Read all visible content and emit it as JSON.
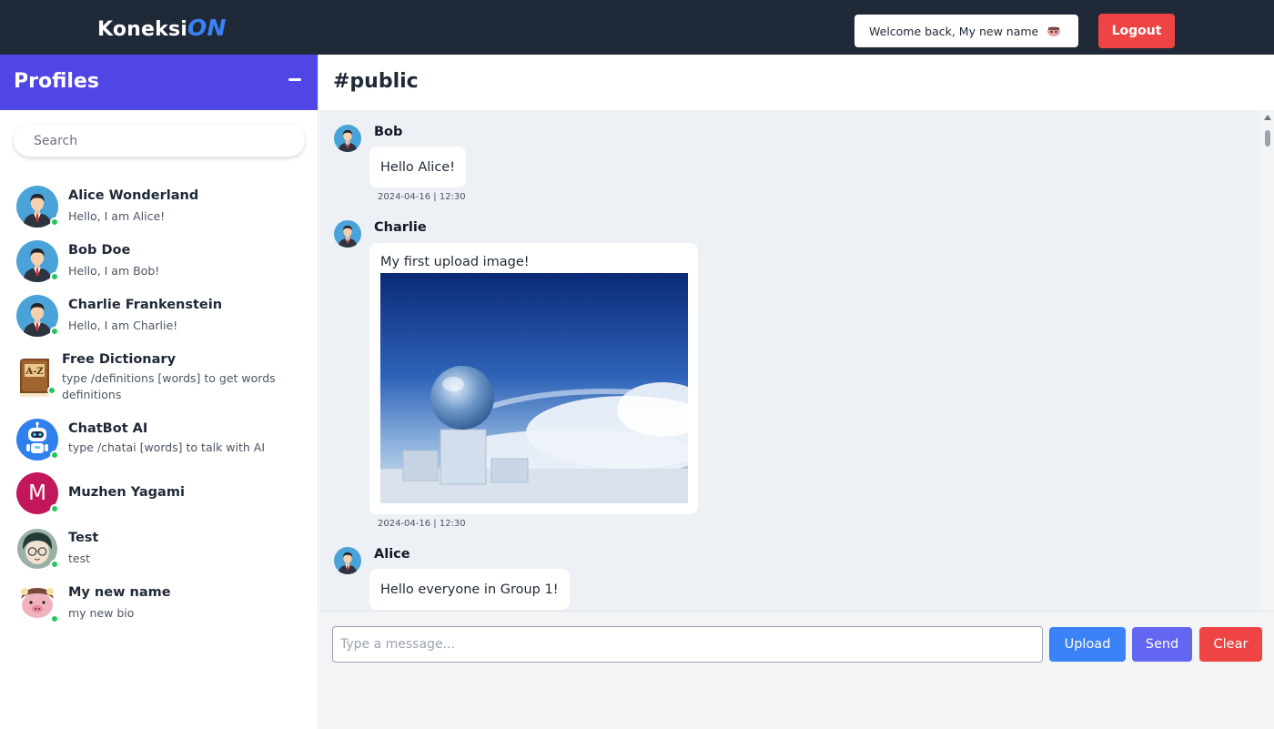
{
  "app": {
    "logo_main": "Koneksi",
    "logo_accent": "ON",
    "welcome_text": "Welcome back, My new name",
    "logout_label": "Logout"
  },
  "sidebar": {
    "title": "Profiles",
    "search_placeholder": "Search",
    "profiles": [
      {
        "name": "Alice Wonderland",
        "bio": "Hello, I am Alice!",
        "avatar": "businessman-icon",
        "online": true
      },
      {
        "name": "Bob Doe",
        "bio": "Hello, I am Bob!",
        "avatar": "businessman-icon",
        "online": true
      },
      {
        "name": "Charlie Frankenstein",
        "bio": "Hello, I am Charlie!",
        "avatar": "businessman-icon",
        "online": true
      },
      {
        "name": "Free Dictionary",
        "bio": "type /definitions [words] to get words definitions",
        "avatar": "dictionary-book-icon",
        "online": true
      },
      {
        "name": "ChatBot AI",
        "bio": "type /chatai [words] to talk with AI",
        "avatar": "robot-icon",
        "online": true
      },
      {
        "name": "Muzhen Yagami",
        "bio": "",
        "avatar": "letter-avatar",
        "avatar_letter": "M",
        "online": true
      },
      {
        "name": "Test",
        "bio": "test",
        "avatar": "anime-boy-icon",
        "online": true
      },
      {
        "name": "My new name",
        "bio": "my new bio",
        "avatar": "pig-character-icon",
        "online": true
      }
    ]
  },
  "channel": {
    "title": "#public",
    "messages": [
      {
        "sender": "Bob",
        "text": "Hello Alice!",
        "time": "2024-04-16 | 12:30",
        "type": "text"
      },
      {
        "sender": "Charlie",
        "text": "My first upload image!",
        "time": "2024-04-16 | 12:30",
        "type": "image",
        "image": "globe-on-pedestals-sky-photo"
      },
      {
        "sender": "Alice",
        "text": "Hello everyone in Group 1!",
        "type": "text"
      }
    ]
  },
  "composer": {
    "placeholder": "Type a message...",
    "upload_label": "Upload",
    "send_label": "Send",
    "clear_label": "Clear"
  },
  "colors": {
    "topbar": "#1f2937",
    "sidebar_header": "#4f46e5",
    "accent": "#3b82f6",
    "danger": "#ef4444",
    "send": "#6366f1",
    "online": "#22c55e"
  }
}
